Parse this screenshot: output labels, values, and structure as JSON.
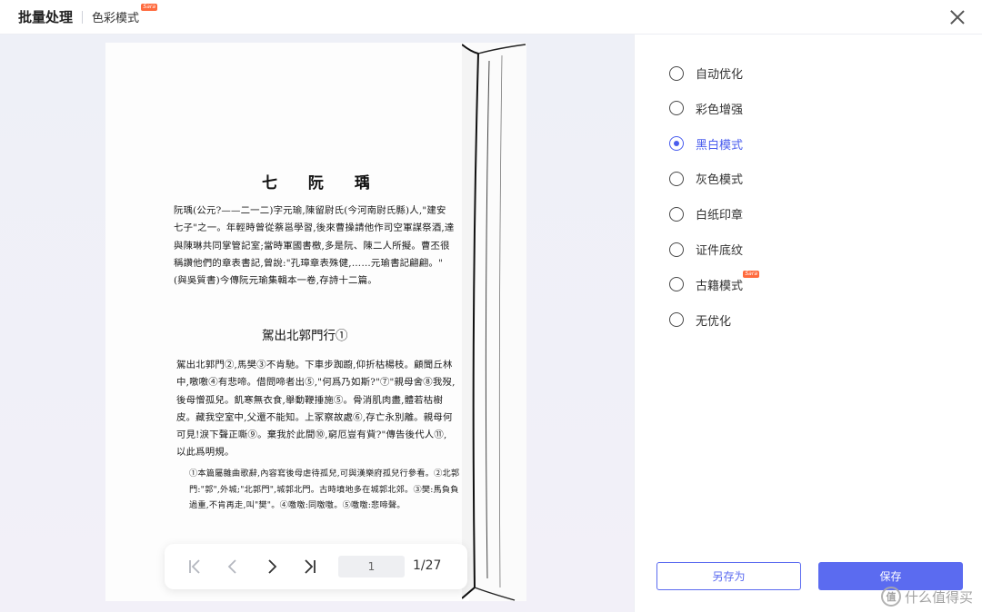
{
  "header": {
    "title": "批量处理",
    "mode_label": "色彩模式",
    "mode_badge": "Sara"
  },
  "page": {
    "chapter_title": "七 阮 瑀",
    "para1": "阮瑀(公元?——二一二)字元瑜,陳留尉氏(今河南尉氏縣)人,\"建安七子\"之一。年輕時曾從蔡邕學習,後來曹操請他作司空軍謀祭酒,達與陳琳共同掌管記室;當時軍國書檄,多是阮、陳二人所擬。曹丕很稱讚他們的章表書記,曾說:\"孔璋章表殊健,……元瑜書記翩翩。\"(與吳質書)今傳阮元瑜集輯本一卷,存詩十二篇。",
    "poem_title": "駕出北郭門行①",
    "para2": "駕出北郭門②,馬樊③不肯馳。下車步踟躕,仰折枯楊枝。顧聞丘林中,噭噭④有悲啼。借問啼者出⑤,\"何爲乃如斯?\"⑦\"親母舍⑧我歿,後母憎孤兒。飢寒無衣食,舉動鞭捶施⑤。骨消肌肉盡,體若枯樹皮。藏我空室中,父還不能知。上冢察故處⑥,存亡永別離。親母何可見!淚下聲正嘶⑨。棄我於此間⑩,窮厄豈有貲?\"傳告後代人⑪,以此爲明規。",
    "notes": "①本篇屬雜曲歌辭,內容寫後母虐待孤兒,可與漢樂府孤兒行參看。②北郭門:\"郭\",外城;\"北郭門\",城郭北門。古時墳地多在城郭北郊。③樊:馬負負過重,不肯再走,叫\"樊\"。④噭噭:同噭噭。⑤噭噭:悲啼聲。"
  },
  "nav": {
    "current_page": "1",
    "total": "1/27"
  },
  "options": [
    {
      "label": "自动优化",
      "badge": ""
    },
    {
      "label": "彩色增强",
      "badge": ""
    },
    {
      "label": "黑白模式",
      "badge": ""
    },
    {
      "label": "灰色模式",
      "badge": ""
    },
    {
      "label": "白纸印章",
      "badge": ""
    },
    {
      "label": "证件底纹",
      "badge": ""
    },
    {
      "label": "古籍模式",
      "badge": "Sara"
    },
    {
      "label": "无优化",
      "badge": ""
    }
  ],
  "selected_option": "黑白模式",
  "buttons": {
    "save_as": "另存为",
    "save": "保存"
  },
  "watermark": {
    "logo": "值",
    "text": "什么值得买"
  },
  "colors": {
    "accent": "#5b6bf0",
    "badge": "#ff6a3d"
  }
}
